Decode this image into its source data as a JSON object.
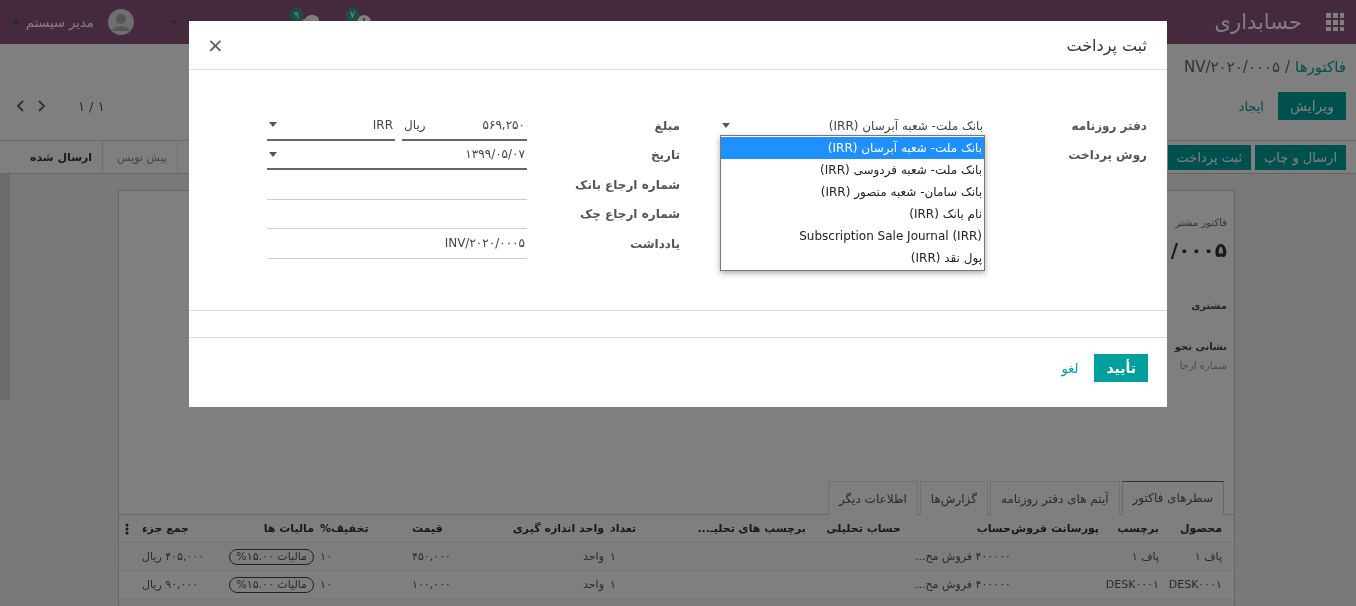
{
  "navbar": {
    "app_title": "حسابداری",
    "activities": "۷",
    "messages": "۹",
    "user": "مدیر سیستم"
  },
  "breadcrumb": {
    "parent": "فاکتورها",
    "separator": "/",
    "current": "NV/۲۰۲۰/۰۰۰۵"
  },
  "actions": {
    "edit": "ویرایش",
    "create": "ایجاد"
  },
  "pager": "۱ / ۱",
  "header_buttons": [
    "ارسال و چاپ",
    "ثبت پرداخت"
  ],
  "status_steps": [
    {
      "label": "پیش نویس",
      "selected": false
    },
    {
      "label": "ارسال شده",
      "selected": true
    }
  ],
  "sheet": {
    "title": "فاکتور مشتر",
    "number": "/۰۰۰۵",
    "customer_label": "مشتری",
    "address_label": "نشانی تحو",
    "ref_label": "شماره ارجا"
  },
  "tabs": [
    {
      "label": "سطرهای فاکتور",
      "selected": true
    },
    {
      "label": "آیتم های دفتر روزنامه",
      "selected": false
    },
    {
      "label": "گزارش‌ها",
      "selected": false
    },
    {
      "label": "اطلاعات دیگر",
      "selected": false
    }
  ],
  "table": {
    "columns": [
      "محصول",
      "برچسب",
      "پورسانت فروش",
      "حساب",
      "حساب تحلیلی",
      "برچسب های تحلیـ...",
      "تعداد",
      "واحد اندازه گیری",
      "قیمت",
      "تخفیف%",
      "مالیات ها",
      "جمع جزء"
    ],
    "rows": [
      {
        "product": "پاف ۱",
        "label": "پاف ۱",
        "account": "۴۰۰۰۰۰ فروش مح...",
        "quantity": "۱",
        "uom": "واحد",
        "price": "۴۵۰,۰۰۰",
        "discount": "۱۰",
        "tax": "مالیات ۱۵.۰۰%",
        "subtotal": "۴۰۵,۰۰۰ ریال"
      },
      {
        "product": "DESK۰۰۰۱",
        "label": "DESK۰۰۰۱",
        "account": "۴۰۰۰۰۰ فروش مح...",
        "quantity": "۱",
        "uom": "واحد",
        "price": "۱۰۰,۰۰۰",
        "discount": "۱۰",
        "tax": "مالیات ۱۵.۰۰%",
        "subtotal": "۹۰,۰۰۰ ریال"
      }
    ]
  },
  "dialog": {
    "title": "ثبت پرداخت",
    "close": "×",
    "journal": {
      "label": "دفتر روزنامه",
      "value": "بانک ملت- شعبه آبرسان (IRR)",
      "options": [
        {
          "label": "بانک ملت- شعبه آبرسان (IRR)",
          "selected": true
        },
        {
          "label": "بانک ملت- شعبه فردوسی (IRR)",
          "selected": false
        },
        {
          "label": "بانک سامان- شعبه منصور (IRR)",
          "selected": false
        },
        {
          "label": "نام بانک (IRR)",
          "selected": false
        },
        {
          "label": "Subscription Sale Journal (IRR)",
          "selected": false
        },
        {
          "label": "پول نقد (IRR)",
          "selected": false
        }
      ]
    },
    "payment_method": {
      "label": "روش پرداخت"
    },
    "amount": {
      "label": "مبلغ",
      "value": "۵۶۹,۲۵۰",
      "unit": "ریال",
      "currency": "IRR"
    },
    "date": {
      "label": "تاریخ",
      "value": "۱۳۹۹/۰۵/۰۷"
    },
    "bank_ref": {
      "label": "شماره ارجاع بانک"
    },
    "check_ref": {
      "label": "شماره ارجاع چک"
    },
    "memo": {
      "label": "یادداشت",
      "value": "INV/۲۰۲۰/۰۰۰۵"
    },
    "confirm": "تأیید",
    "cancel": "لغو"
  }
}
